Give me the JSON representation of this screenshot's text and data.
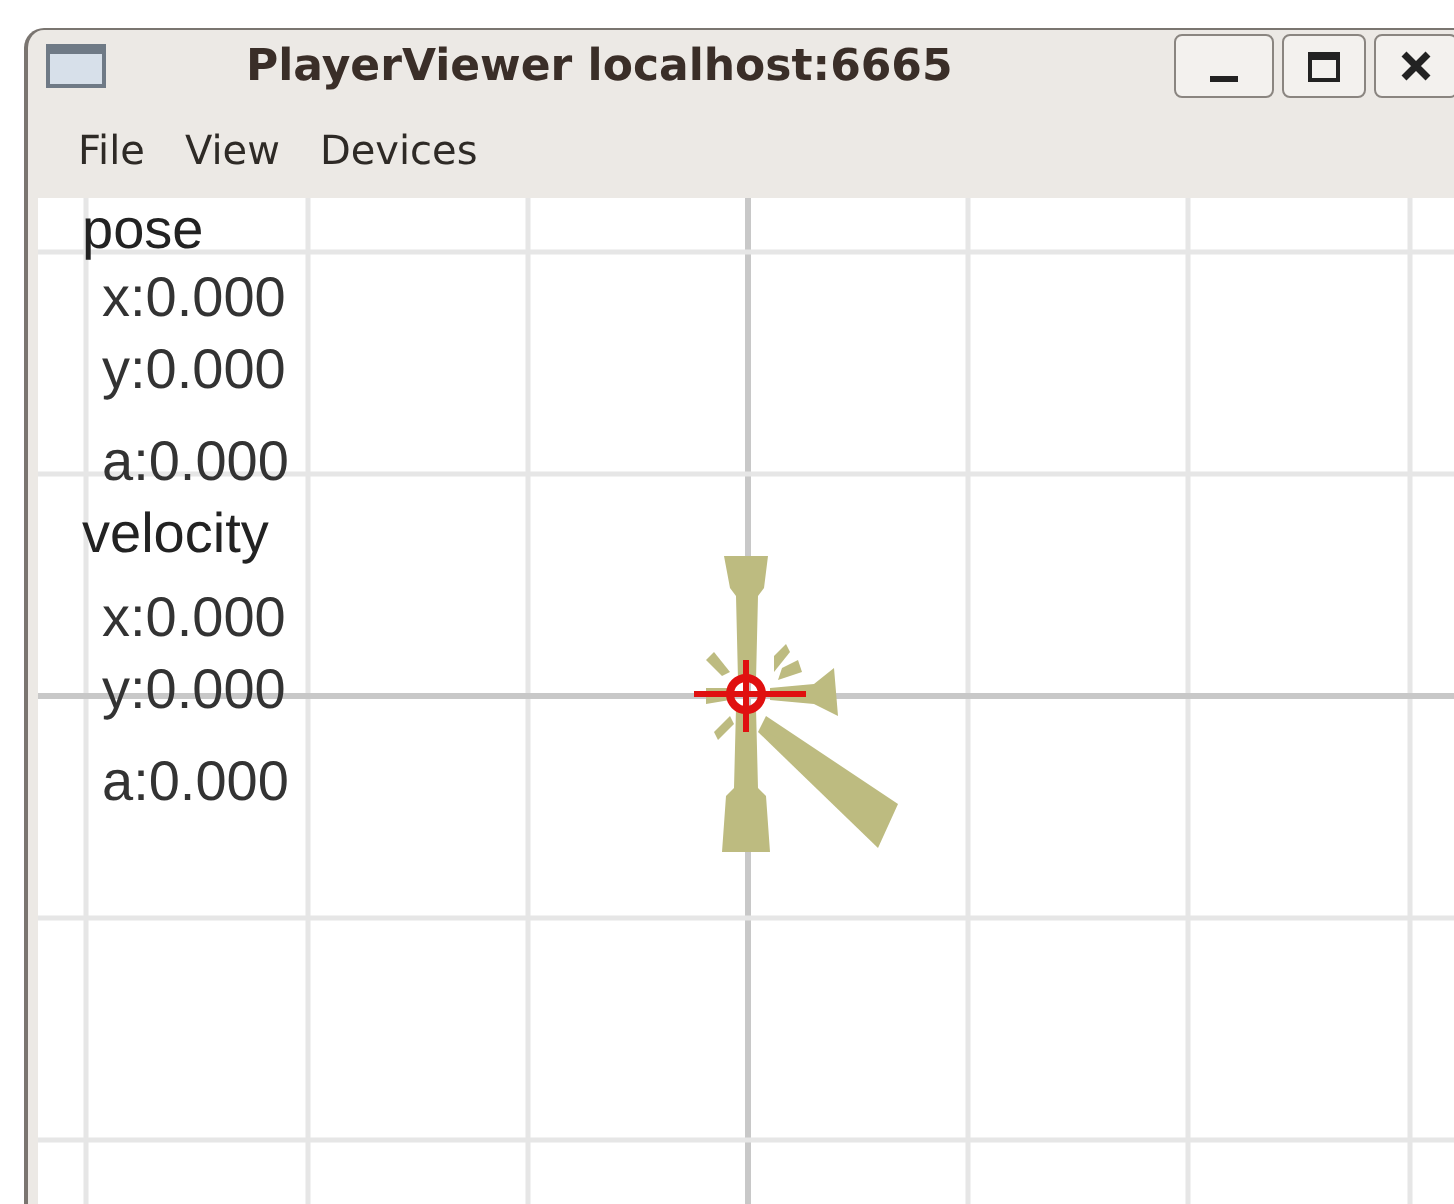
{
  "window": {
    "title": "PlayerViewer localhost:6665"
  },
  "menu": [
    "File",
    "View",
    "Devices"
  ],
  "readouts": [
    {
      "label": "pose",
      "values": [
        "x:0.000",
        "y:0.000",
        "a:0.000"
      ]
    },
    {
      "label": "velocity",
      "values": [
        "x:0.000",
        "y:0.000",
        "a:0.000"
      ]
    }
  ]
}
